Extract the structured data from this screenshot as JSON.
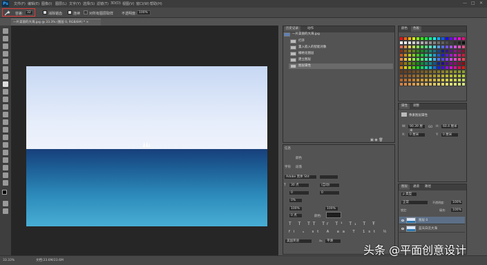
{
  "menubar": {
    "logo": "Ps",
    "items": [
      "文件(F)",
      "编辑(E)",
      "图像(I)",
      "图层(L)",
      "文字(Y)",
      "选择(S)",
      "滤镜(T)",
      "3D(D)",
      "视图(V)",
      "窗口(W)",
      "帮助(H)"
    ],
    "win_min": "—",
    "win_max": "□",
    "win_close": "✕"
  },
  "options": {
    "tolerance_label": "容差:",
    "tolerance_value": "32",
    "antialias_label": "消除锯齿",
    "contiguous_label": "连续",
    "sample_all_label": "对所有图层取样",
    "opacity_label": "不透明度:",
    "opacity_value": "100%"
  },
  "doc_tab": {
    "title": "一片美丽的大海.jpg @ 33.3% (图层 0, RGB/8#) *",
    "close": "×"
  },
  "history": {
    "tabs": [
      "历史记录",
      "动作"
    ],
    "snapshot": "一片美丽的大海.jpg",
    "items": [
      "打开",
      "置入嵌入的智能对象",
      "栅格化图层",
      "建立图层",
      "图层属性"
    ]
  },
  "swatches": {
    "tabs": [
      "颜色",
      "色板"
    ]
  },
  "properties": {
    "tabs": [
      "属性",
      "调整"
    ],
    "title": "像素图层属性",
    "w_label": "W:",
    "w_value": "90.39 厘米",
    "go_label": "GO",
    "h_label": "H:",
    "h_value": "60.4 厘米",
    "x_label": "X:",
    "x_value": "0 厘米",
    "y_label": "Y:",
    "y_value": "0 厘米"
  },
  "mid_panels": {
    "panel1_tabs": [
      "信息",
      "颜色",
      "字符"
    ],
    "info_label": "信息",
    "sub1": "颜色",
    "sub2": "段落",
    "sub3": "字符"
  },
  "character": {
    "font": "Adobe 黑体 Std",
    "size": "30 点",
    "leading": "(自动)",
    "tracking_va": "0",
    "tracking": "0",
    "scale_pct": "0%",
    "vscale": "100%",
    "hscale": "100%",
    "baseline": "0 点",
    "color_label": "颜色:",
    "styles": [
      "T",
      "T",
      "TT",
      "Tr",
      "T¹",
      "T₁",
      "T",
      "Ŧ"
    ],
    "extras": [
      "fi",
      "ℴ",
      "st",
      "A",
      "aa",
      "T",
      "1st",
      "½"
    ],
    "lang": "美国英语",
    "aa_label": "aₐ",
    "aa_value": "平滑"
  },
  "layers": {
    "tabs": [
      "图层",
      "通道",
      "路径"
    ],
    "kind_label": "ρ 类型",
    "blend": "正常",
    "opacity_label": "不透明度:",
    "opacity_value": "100%",
    "lock_label": "锁定:",
    "fill_label": "填充:",
    "fill_value": "100%",
    "items": [
      "图层 0",
      "蓝天白云大海"
    ]
  },
  "status": {
    "zoom": "33.33%",
    "doc_label": "文档:23.6M/23.6M"
  },
  "watermark": "头条 @平面创意设计"
}
